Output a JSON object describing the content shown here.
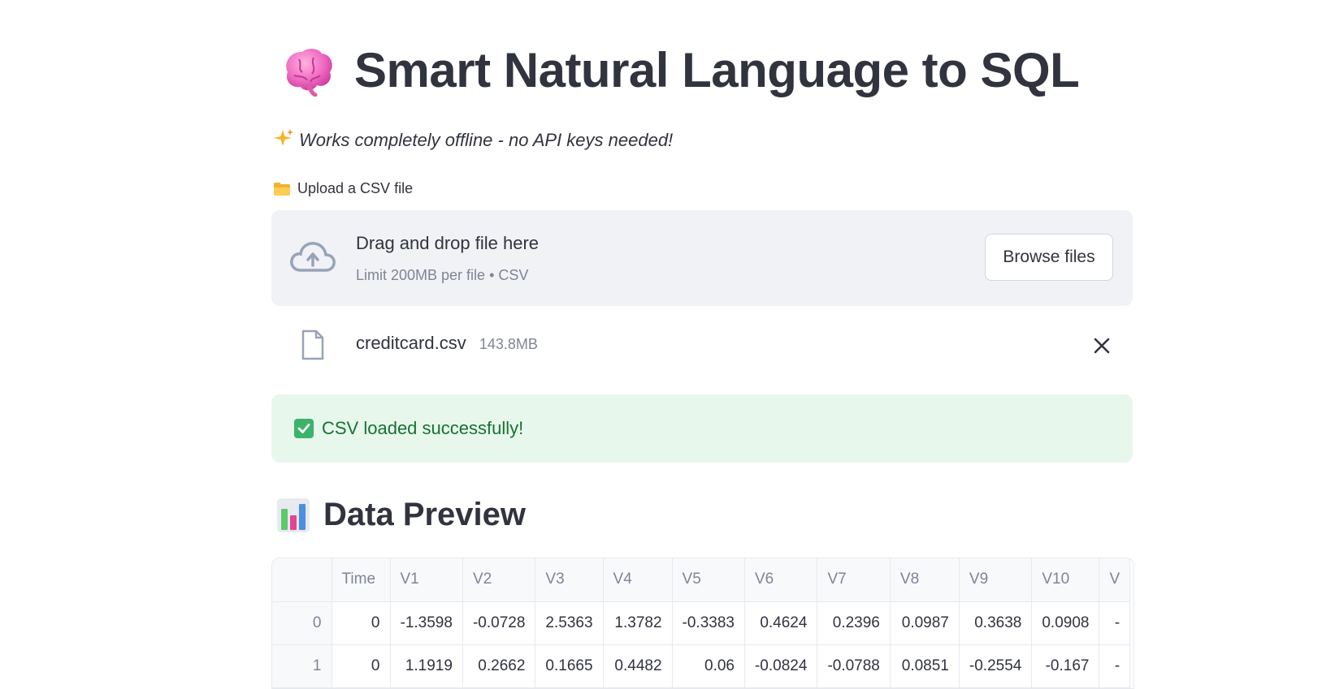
{
  "header": {
    "title_icon": "brain-emoji",
    "title": "Smart Natural Language to SQL",
    "subtitle_icon": "sparkles-emoji",
    "subtitle": "Works completely offline - no API keys needed!"
  },
  "uploader": {
    "label_icon": "folder-emoji",
    "label": "Upload a CSV file",
    "dropzone_icon": "cloud-upload-icon",
    "dropzone_text": "Drag and drop file here",
    "dropzone_limit": "Limit 200MB per file • CSV",
    "browse_label": "Browse files"
  },
  "uploaded_file": {
    "icon": "file-icon",
    "name": "creditcard.csv",
    "size": "143.8MB",
    "remove_icon": "close-icon"
  },
  "status": {
    "icon": "check-mark-emoji",
    "message": "CSV loaded successfully!",
    "color": "#177233",
    "background": "#e8f7ec"
  },
  "preview": {
    "icon": "bar-chart-emoji",
    "title": "Data Preview",
    "columns": [
      "",
      "Time",
      "V1",
      "V2",
      "V3",
      "V4",
      "V5",
      "V6",
      "V7",
      "V8",
      "V9",
      "V10",
      "V"
    ],
    "rows": [
      [
        "0",
        "0",
        "-1.3598",
        "-0.0728",
        "2.5363",
        "1.3782",
        "-0.3383",
        "0.4624",
        "0.2396",
        "0.0987",
        "0.3638",
        "0.0908",
        "-"
      ],
      [
        "1",
        "0",
        "1.1919",
        "0.2662",
        "0.1665",
        "0.4482",
        "0.06",
        "-0.0824",
        "-0.0788",
        "0.0851",
        "-0.2554",
        "-0.167",
        "-"
      ]
    ]
  }
}
